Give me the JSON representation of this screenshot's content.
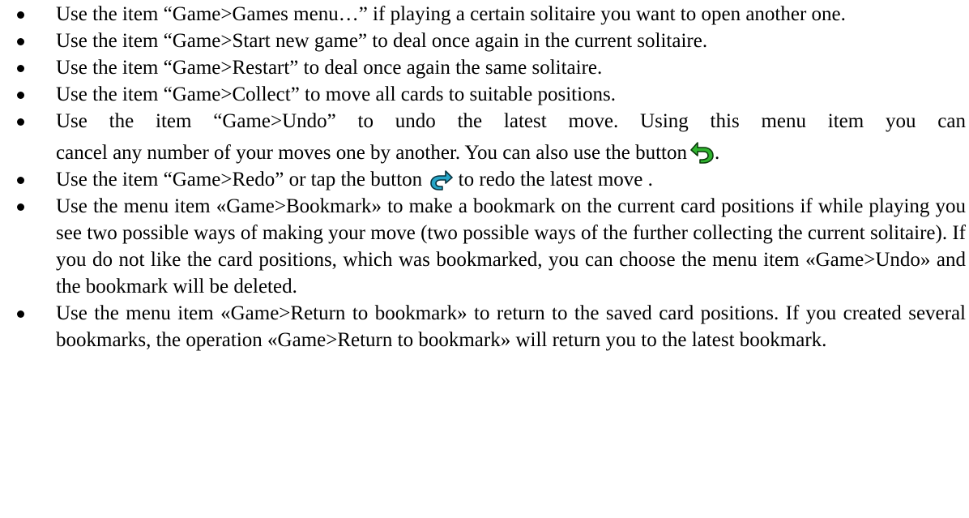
{
  "items": [
    {
      "text": "Use the item “Game>Games menu…” if playing a certain solitaire you want to open another one."
    },
    {
      "text": "Use the item “Game>Start new game” to deal once again in the current solitaire."
    },
    {
      "text": "Use the item “Game>Restart” to deal once again the same solitaire."
    },
    {
      "text": "Use the item “Game>Collect” to move all cards to suitable positions."
    },
    {
      "line1": "Use the item “Game>Undo” to undo the latest move. Using this menu item you can",
      "line2": "cancel any number of your moves one by another. You can also use the button",
      "line2_end": "."
    },
    {
      "before": "Use the item “Game>Redo” or tap the button",
      "after": "to redo the latest move ."
    },
    {
      "text": "Use the menu item «Game>Bookmark» to make a bookmark on the current card positions if while playing you see two possible ways of making your move (two possible ways of the further collecting the current solitaire). If you do not like the card positions, which was bookmarked, you can choose the menu item «Game>Undo» and the bookmark will be deleted."
    },
    {
      "text": "Use the menu item «Game>Return to bookmark» to return to the saved card positions. If you created several bookmarks, the operation «Game>Return to bookmark» will return you to the latest bookmark."
    }
  ],
  "icons": {
    "undo": {
      "name": "undo-arrow-icon",
      "fill": "#2fb52f",
      "stroke": "#0a3a0a"
    },
    "redo": {
      "name": "redo-arrow-icon",
      "fill": "#27a6c8",
      "stroke": "#08333f"
    }
  }
}
